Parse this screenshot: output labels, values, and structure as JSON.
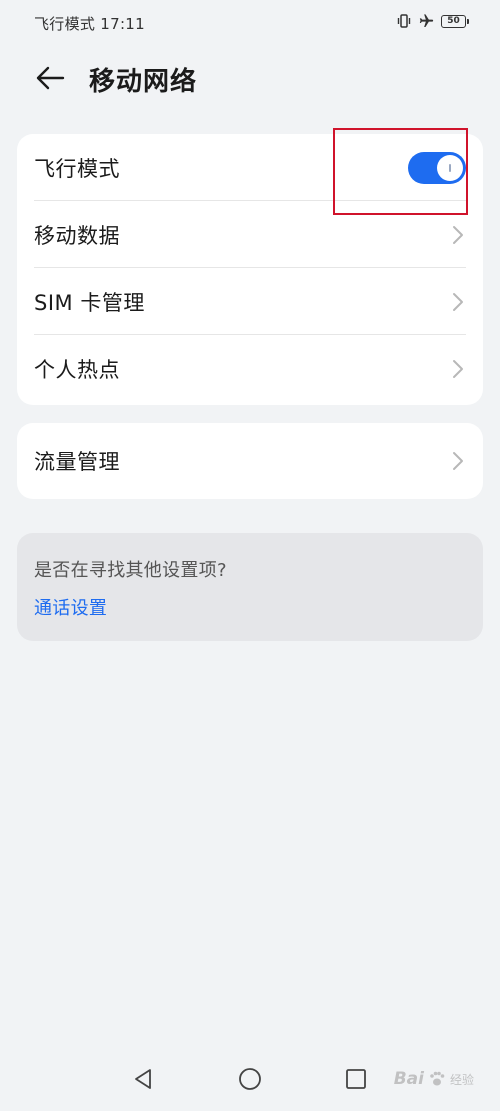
{
  "status_bar": {
    "text": "飞行模式 17:11",
    "icons": [
      "vibrate-icon",
      "airplane-icon",
      "battery-icon"
    ],
    "battery_level": "50"
  },
  "header": {
    "back_icon": "arrow-left-icon",
    "title": "移动网络"
  },
  "settings_group": {
    "items": [
      {
        "label": "飞行模式",
        "control": "toggle",
        "toggle_on": true
      },
      {
        "label": "移动数据",
        "control": "chevron"
      },
      {
        "label": "SIM 卡管理",
        "control": "chevron"
      },
      {
        "label": "个人热点",
        "control": "chevron"
      }
    ]
  },
  "traffic_group": {
    "items": [
      {
        "label": "流量管理",
        "control": "chevron"
      }
    ]
  },
  "suggestion": {
    "question": "是否在寻找其他设置项?",
    "link": "通话设置"
  },
  "nav_bar": {
    "buttons": [
      "nav-back-icon",
      "nav-home-icon",
      "nav-recent-icon"
    ]
  },
  "watermark": {
    "text": "Bai",
    "sub": "经验"
  },
  "colors": {
    "background": "#f1f3f5",
    "card": "#ffffff",
    "accent": "#1e6cf0",
    "highlight": "#d0132b",
    "suggestion_bg": "#e5e6e9"
  }
}
